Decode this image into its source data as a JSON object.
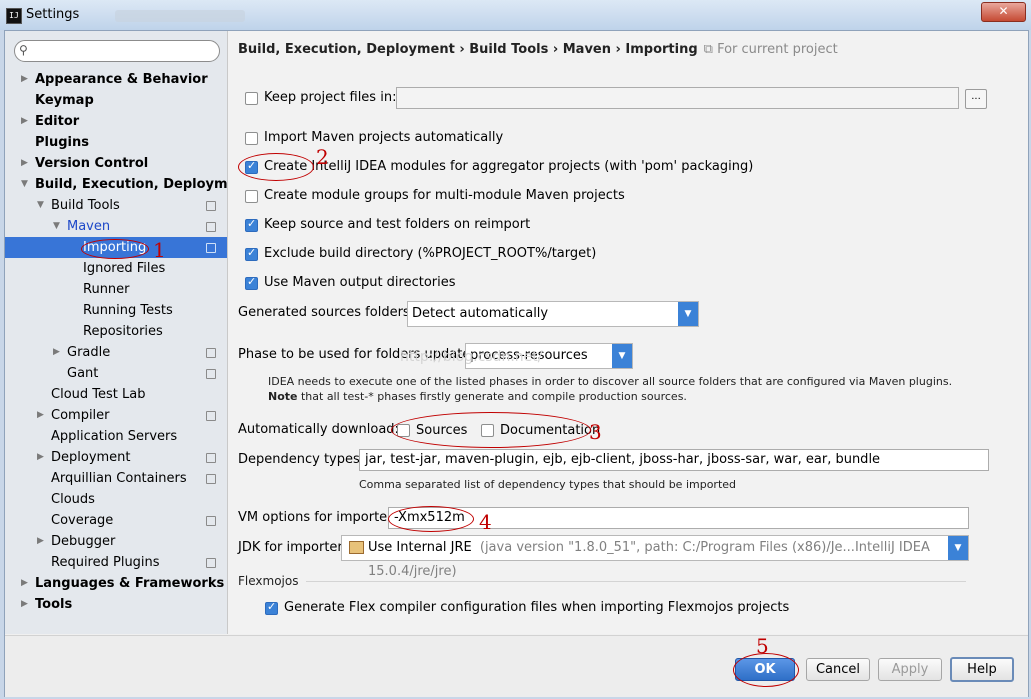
{
  "window": {
    "title": "Settings",
    "app_icon": "IJ",
    "close_glyph": "✕"
  },
  "search": {
    "placeholder": "",
    "value": "",
    "icon": "search-icon"
  },
  "sidebar": {
    "items": [
      {
        "label": "Appearance & Behavior",
        "bold": true
      },
      {
        "label": "Keymap",
        "bold": true
      },
      {
        "label": "Editor",
        "bold": true
      },
      {
        "label": "Plugins",
        "bold": true
      },
      {
        "label": "Version Control",
        "bold": true
      },
      {
        "label": "Build, Execution, Deployment",
        "bold": true,
        "expanded": true
      },
      {
        "label": "Build Tools"
      },
      {
        "label": "Maven"
      },
      {
        "label": "Importing",
        "selected": true
      },
      {
        "label": "Ignored Files"
      },
      {
        "label": "Runner"
      },
      {
        "label": "Running Tests"
      },
      {
        "label": "Repositories"
      },
      {
        "label": "Gradle"
      },
      {
        "label": "Gant"
      },
      {
        "label": "Cloud Test Lab"
      },
      {
        "label": "Compiler"
      },
      {
        "label": "Application Servers"
      },
      {
        "label": "Deployment"
      },
      {
        "label": "Arquillian Containers"
      },
      {
        "label": "Clouds"
      },
      {
        "label": "Coverage"
      },
      {
        "label": "Debugger"
      },
      {
        "label": "Required Plugins"
      },
      {
        "label": "Languages & Frameworks",
        "bold": true
      },
      {
        "label": "Tools",
        "bold": true
      }
    ]
  },
  "breadcrumb": {
    "path": "Build, Execution, Deployment › Build Tools › Maven › Importing",
    "scope": "For current project"
  },
  "options": {
    "keep_project_files": {
      "label": "Keep project files in:",
      "checked": false,
      "value": "",
      "browse": "..."
    },
    "import_automatically": {
      "label": "Import Maven projects automatically",
      "checked": false
    },
    "create_modules": {
      "label": "Create IntelliJ IDEA modules for aggregator projects (with 'pom' packaging)",
      "checked": true
    },
    "module_groups": {
      "label": "Create module groups for multi-module Maven projects",
      "checked": false
    },
    "keep_source_folders": {
      "label": "Keep source and test folders on reimport",
      "checked": true
    },
    "exclude_build_dir": {
      "label": "Exclude build directory (%PROJECT_ROOT%/target)",
      "checked": true
    },
    "use_output_dirs": {
      "label": "Use Maven output directories",
      "checked": true
    },
    "generated_sources": {
      "label": "Generated sources folders:",
      "value": "Detect automatically"
    },
    "phase": {
      "label": "Phase to be used for folders update:",
      "value": "process-resources",
      "help1": "IDEA needs to execute one of the listed phases in order to discover all source folders that are configured via Maven plugins.",
      "help2_bold": "Note",
      "help2_rest": " that all test-* phases firstly generate and compile production sources."
    },
    "auto_download": {
      "label": "Automatically download:",
      "sources": "Sources",
      "documentation": "Documentation",
      "sources_checked": false,
      "documentation_checked": false
    },
    "dependency_types": {
      "label": "Dependency types:",
      "value": "jar, test-jar, maven-plugin, ejb, ejb-client, jboss-har, jboss-sar, war, ear, bundle",
      "hint": "Comma separated list of dependency types that should be imported"
    },
    "vm_options": {
      "label": "VM options for importer:",
      "value": "-Xmx512m"
    },
    "jdk": {
      "label": "JDK for importer:",
      "value": "Use Internal JRE",
      "detail": "(java version \"1.8.0_51\", path: C:/Program Files (x86)/Je...IntelliJ IDEA 15.0.4/jre/jre)"
    },
    "flexmojos_section": "Flexmojos",
    "flexmojos_generate": {
      "label": "Generate Flex compiler configuration files when importing Flexmojos projects",
      "checked": true
    }
  },
  "annotations": [
    "1",
    "2",
    "3",
    "4",
    "5"
  ],
  "watermark": "http://blog.csdn.net/",
  "buttons": {
    "ok": "OK",
    "cancel": "Cancel",
    "apply": "Apply",
    "help": "Help"
  },
  "colors": {
    "accent": "#3875d7",
    "annotation_red": "#c00000"
  }
}
